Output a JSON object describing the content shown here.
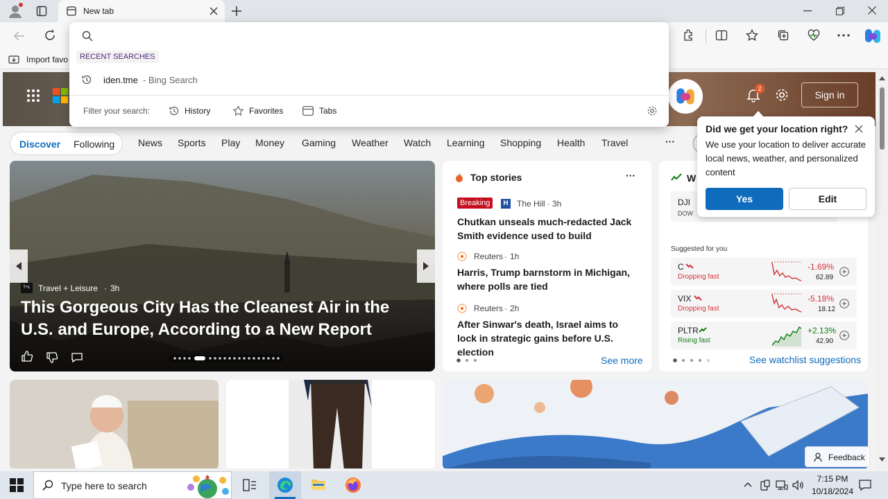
{
  "browser": {
    "tab_title": "New tab",
    "favorites_bar_label": "Import favo"
  },
  "search_dropdown": {
    "section_label": "RECENT SEARCHES",
    "recent": [
      {
        "query": "iden.tme",
        "suffix": "- Bing Search"
      }
    ],
    "filter_label": "Filter your search:",
    "filters": [
      "History",
      "Favorites",
      "Tabs"
    ]
  },
  "header": {
    "notification_count": "2",
    "sign_in_label": "Sign in"
  },
  "nav": {
    "pills": [
      "Discover",
      "Following"
    ],
    "items": [
      "News",
      "Sports",
      "Play",
      "Money",
      "Gaming",
      "Weather",
      "Watch",
      "Learning",
      "Shopping",
      "Health",
      "Travel"
    ],
    "more": "···"
  },
  "hero": {
    "source": "Travel + Leisure",
    "source_logo_text": "T+L",
    "age": "3h",
    "title": "This Gorgeous City Has the Cleanest Air in the U.S. and Europe, According to a New Report"
  },
  "top_stories": {
    "title": "Top stories",
    "more": "···",
    "items": [
      {
        "badge": "Breaking",
        "source": "The Hill",
        "age": "3h",
        "headline": "Chutkan unseals much-redacted Jack Smith evidence used to build Trump’s..."
      },
      {
        "source": "Reuters",
        "age": "1h",
        "headline": "Harris, Trump barnstorm in Michigan, where polls are tied"
      },
      {
        "source": "Reuters",
        "age": "2h",
        "headline": "After Sinwar's death, Israel aims to lock in strategic gains before U.S. election"
      }
    ],
    "see_more": "See more"
  },
  "watchlist": {
    "title_partial": "W",
    "index": {
      "symbol": "DJI",
      "name": "DOW"
    },
    "suggested_label": "Suggested for you",
    "stocks": [
      {
        "symbol": "C",
        "status": "Dropping fast",
        "change": "-1.69%",
        "price": "62.89",
        "trend": "down"
      },
      {
        "symbol": "VIX",
        "status": "Dropping fast",
        "change": "-5.18%",
        "price": "18.12",
        "trend": "down"
      },
      {
        "symbol": "PLTR",
        "status": "Rising fast",
        "change": "+2.13%",
        "price": "42.90",
        "trend": "up"
      }
    ],
    "see_suggestions": "See watchlist suggestions"
  },
  "location_popup": {
    "title": "Did we get your location right?",
    "body": "We use your location to deliver accurate local news, weather, and personalized content",
    "yes_label": "Yes",
    "edit_label": "Edit"
  },
  "feedback_label": "Feedback",
  "taskbar": {
    "search_placeholder": "Type here to search",
    "time": "7:15 PM",
    "date": "10/18/2024"
  },
  "colors": {
    "accent": "#0f6cbd",
    "breaking": "#c50f1f",
    "down": "#d13438",
    "up": "#107c10"
  }
}
